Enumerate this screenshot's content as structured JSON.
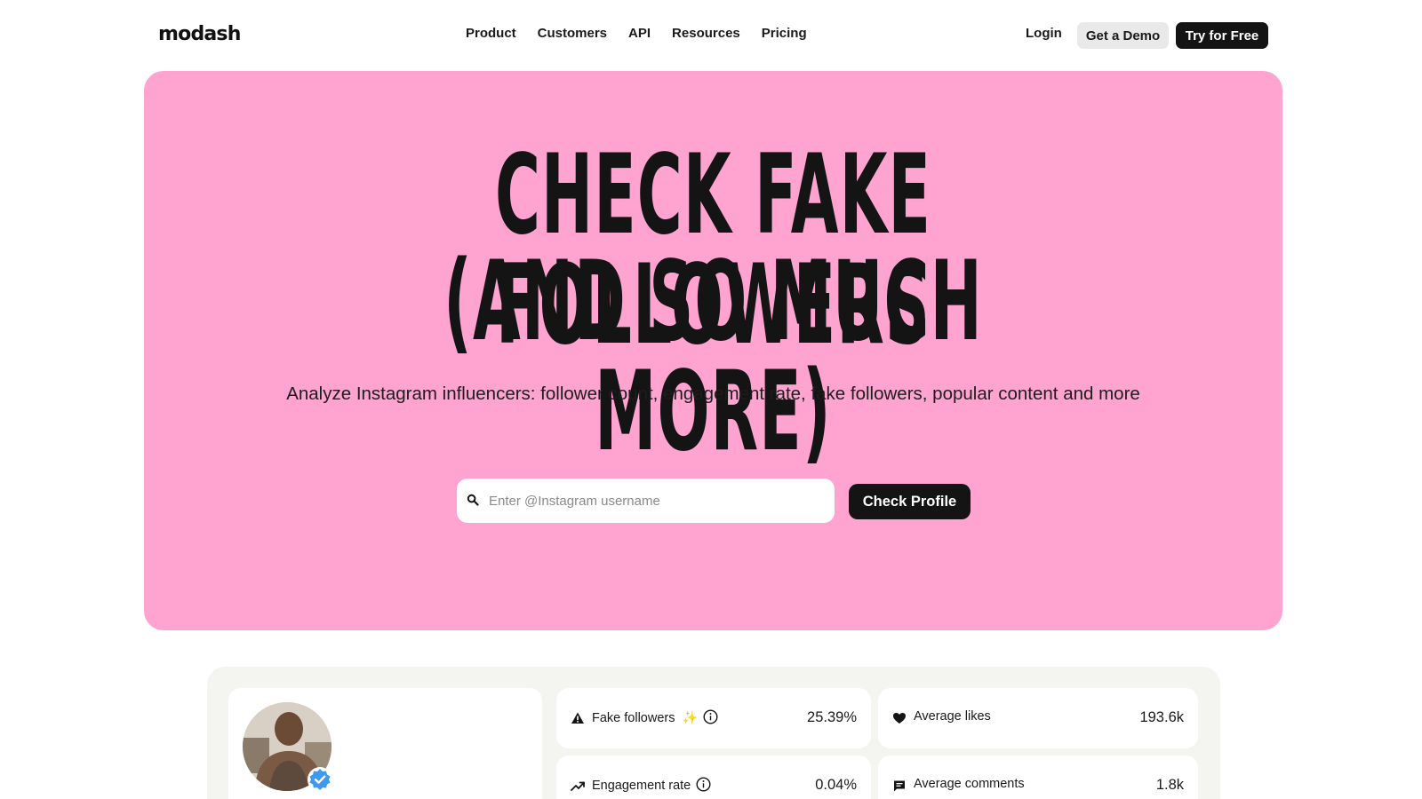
{
  "nav": {
    "logo": "modash",
    "links": [
      "Product",
      "Customers",
      "API",
      "Resources",
      "Pricing"
    ],
    "login": "Login",
    "demo": "Get a Demo",
    "try": "Try for Free"
  },
  "hero": {
    "title_line1": "CHECK FAKE FOLLOWERS",
    "title_line2": "(AND SO MUCH MORE)",
    "subtitle": "Analyze Instagram influencers: follower count, engagement rate, fake followers, popular content and more",
    "search_placeholder": "Enter @Instagram username",
    "search_value": "",
    "button": "Check Profile",
    "background": "#ffa3d1"
  },
  "preview": {
    "stats": [
      {
        "label": "Fake followers",
        "value": "25.39%",
        "icon": "warning-icon",
        "sparkle": "✨"
      },
      {
        "label": "Average likes",
        "value": "193.6k",
        "icon": "heart-icon"
      },
      {
        "label": "Engagement rate",
        "value": "0.04%",
        "icon": "trending-up-icon"
      },
      {
        "label": "Average comments",
        "value": "1.8k",
        "icon": "comment-icon"
      }
    ]
  }
}
